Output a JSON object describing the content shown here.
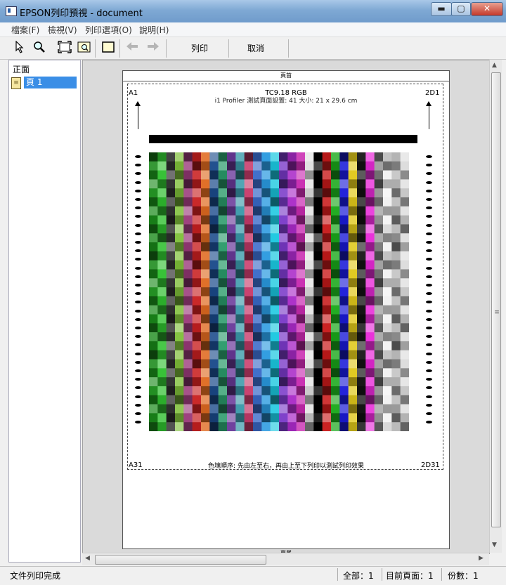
{
  "window": {
    "title": "EPSON列印預視 - document",
    "minimize_label": "▬",
    "maximize_label": "▢",
    "close_label": "✕"
  },
  "menu": {
    "items": [
      "檔案(F)",
      "檢視(V)",
      "列印選項(O)",
      "說明(H)"
    ]
  },
  "toolbar": {
    "icons": [
      "pointer-icon",
      "zoom-icon",
      "fit-page-icon",
      "zoom-page-icon",
      "page-frame-icon",
      "back-arrow-icon",
      "forward-arrow-icon"
    ],
    "print_label": "列印",
    "cancel_label": "取消"
  },
  "left_panel": {
    "heading": "正面",
    "items": [
      {
        "label": "頁 1",
        "selected": true
      }
    ]
  },
  "page": {
    "header_text": "頁首",
    "footer_text": "頁尾",
    "corner_tl": "A1",
    "corner_tr": "2D1",
    "corner_bl": "A31",
    "corner_br": "2D31",
    "title": "TC9.18 RGB",
    "subtitle": "i1 Profiler 測試頁面設置: 41 大小: 21 x 29.6 cm",
    "footnote": "色塊順序: 先由左至右，再由上至下列印以測試列印效果"
  },
  "chart_data": {
    "type": "heatmap",
    "columns": 30,
    "rows": 31,
    "description_colors": {
      "column_hues": [
        "#1a8a1a",
        "#2fbf2f",
        "#3a3a3a",
        "#7fbf3a",
        "#9a3a7a",
        "#c82020",
        "#e06a20",
        "#1a4a8a",
        "#2a9a6a",
        "#6a3a9a",
        "#3a9aaa",
        "#c83a6a",
        "#3a6ac8",
        "#2a9ae0",
        "#1ac8e0",
        "#7a3ac8",
        "#aa2ac8",
        "#c82ab0",
        "#e0e0e0",
        "#000000",
        "#c81a1a",
        "#1aa81a",
        "#1a1ad8",
        "#e0c81a",
        "#1a1a1a",
        "#e82ad8",
        "#8a8a8a",
        "#f0f0f0",
        "#aaaaaa",
        "#dcdcdc"
      ]
    }
  },
  "status": {
    "left_text": "文件列印完成",
    "total": "全部：1",
    "current": "目前頁面：1",
    "copies": "份數：1"
  }
}
